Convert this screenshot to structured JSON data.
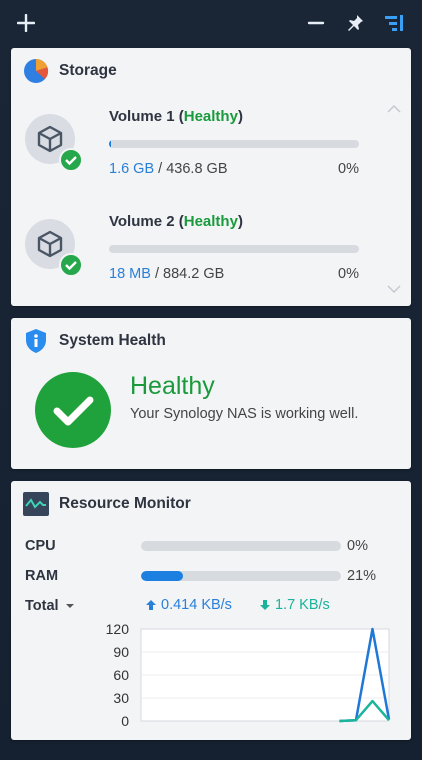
{
  "topbar": {
    "add_icon": "plus-icon",
    "minimize_icon": "minus-icon",
    "pin_icon": "pin-icon",
    "layout_icon": "panel-layout-icon"
  },
  "storage": {
    "title": "Storage",
    "volumes": [
      {
        "name": "Volume 1",
        "status": "Healthy",
        "used": "1.6 GB",
        "total": "436.8 GB",
        "percent": "0%",
        "fill": 0.004
      },
      {
        "name": "Volume 2",
        "status": "Healthy",
        "used": "18 MB",
        "total": "884.2 GB",
        "percent": "0%",
        "fill": 0.0
      }
    ]
  },
  "system_health": {
    "title": "System Health",
    "status": "Healthy",
    "description": "Your Synology NAS is working well."
  },
  "resource_monitor": {
    "title": "Resource Monitor",
    "cpu": {
      "label": "CPU",
      "percent": "0%",
      "fill": 0.0
    },
    "ram": {
      "label": "RAM",
      "percent": "21%",
      "fill": 0.21
    },
    "total": {
      "label": "Total",
      "upload": "0.414 KB/s",
      "download": "1.7 KB/s"
    },
    "chart_data": {
      "type": "line",
      "y_ticks": [
        "120",
        "90",
        "60",
        "30",
        "0"
      ],
      "ylim": [
        0,
        120
      ],
      "x": [
        0,
        1,
        2,
        3,
        4,
        5,
        6,
        7,
        8,
        9,
        10,
        11,
        12,
        13,
        14,
        15
      ],
      "series": [
        {
          "color": "#1f78d6",
          "values": [
            null,
            null,
            null,
            null,
            null,
            null,
            null,
            null,
            null,
            null,
            null,
            null,
            0,
            1,
            120,
            2
          ]
        },
        {
          "color": "#1bb59b",
          "values": [
            null,
            null,
            null,
            null,
            null,
            null,
            null,
            null,
            null,
            null,
            null,
            null,
            0,
            1,
            26,
            1
          ]
        }
      ]
    }
  },
  "colors": {
    "accent": "#1d7fe0",
    "healthy": "#1a9a3c",
    "download": "#19b39a"
  }
}
